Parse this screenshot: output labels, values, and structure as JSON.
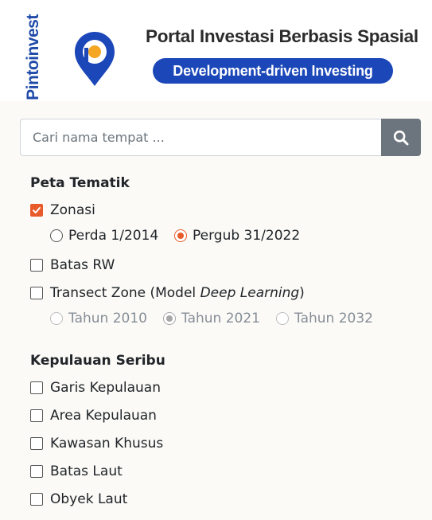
{
  "header": {
    "brand_name": "Pintoinvest",
    "title": "Portal Investasi Berbasis Spasial",
    "tagline": "Development-driven Investing",
    "colors": {
      "brand_blue": "#1b47b8",
      "pin_orange": "#f5a623"
    }
  },
  "search": {
    "placeholder": "Cari nama tempat ...",
    "value": "",
    "button_icon": "search-icon"
  },
  "peta_tematik": {
    "title": "Peta Tematik",
    "zonasi": {
      "label": "Zonasi",
      "checked": true,
      "options": [
        {
          "label": "Perda 1/2014",
          "selected": false
        },
        {
          "label": "Pergub 31/2022",
          "selected": true
        }
      ]
    },
    "batas_rw": {
      "label": "Batas RW",
      "checked": false
    },
    "transect": {
      "label_prefix": "Transect Zone (Model ",
      "label_emphasis": "Deep Learning",
      "label_suffix": ")",
      "checked": false,
      "options": [
        {
          "label": "Tahun 2010",
          "selected": false,
          "disabled": true
        },
        {
          "label": "Tahun 2021",
          "selected": true,
          "disabled": true
        },
        {
          "label": "Tahun 2032",
          "selected": false,
          "disabled": true
        }
      ]
    }
  },
  "kepulauan": {
    "title": "Kepulauan Seribu",
    "items": [
      {
        "label": "Garis Kepulauan",
        "checked": false
      },
      {
        "label": "Area Kepulauan",
        "checked": false
      },
      {
        "label": "Kawasan Khusus",
        "checked": false
      },
      {
        "label": "Batas Laut",
        "checked": false
      },
      {
        "label": "Obyek Laut",
        "checked": false
      }
    ]
  },
  "accent_color": "#e85a2a"
}
